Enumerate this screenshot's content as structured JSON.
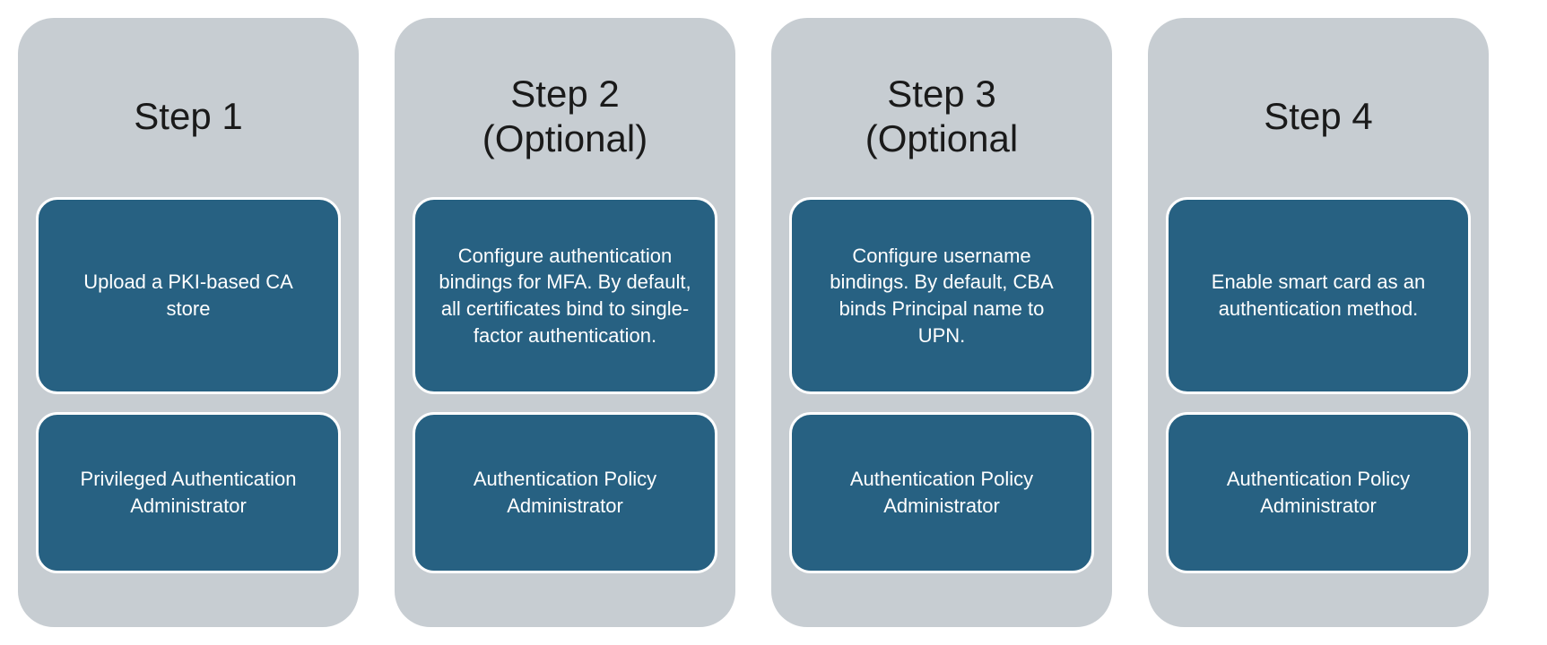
{
  "steps": [
    {
      "title": "Step 1",
      "description": "Upload a PKI-based CA store",
      "role": "Privileged Authentication Administrator"
    },
    {
      "title": "Step 2\n(Optional)",
      "description": "Configure authentication bindings for MFA. By default, all certificates bind to single-factor authentication.",
      "role": "Authentication Policy Administrator"
    },
    {
      "title": "Step 3\n(Optional",
      "description": "Configure username bindings. By default, CBA binds Principal name to UPN.",
      "role": "Authentication Policy Administrator"
    },
    {
      "title": "Step 4",
      "description": "Enable smart card as an authentication method.",
      "role": "Authentication Policy Administrator"
    }
  ]
}
